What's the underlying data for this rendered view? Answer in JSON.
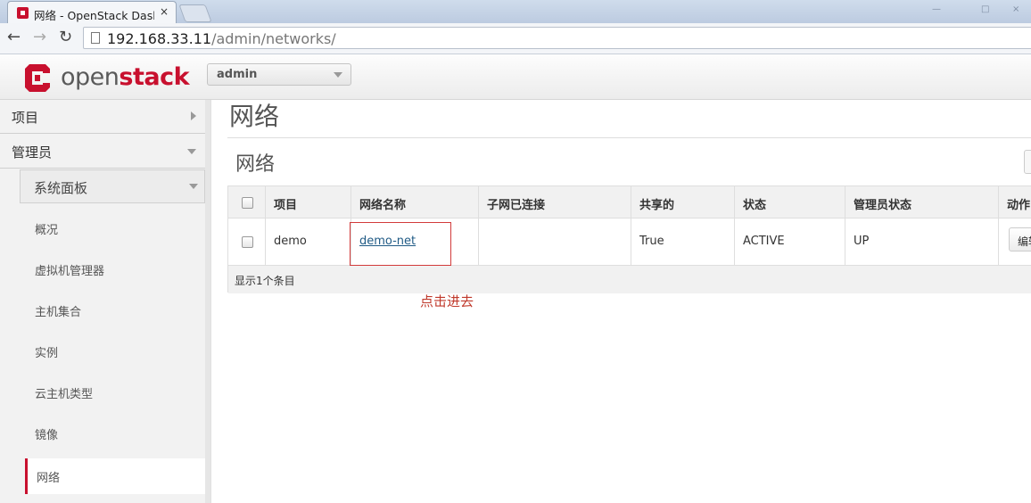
{
  "browser": {
    "tab_title": "网络 - OpenStack Dashb",
    "tab_close": "×",
    "url_host": "192.168.33.11",
    "url_path": "/admin/networks/",
    "window_controls": [
      "—",
      "□",
      "×"
    ]
  },
  "header": {
    "logo_open": "open",
    "logo_stack": "stack",
    "project": "admin"
  },
  "sidebar": {
    "project_label": "项目",
    "admin_label": "管理员",
    "system_panel_label": "系统面板",
    "items": [
      "概况",
      "虚拟机管理器",
      "主机集合",
      "实例",
      "云主机类型",
      "镜像",
      "网络"
    ],
    "active_item": "网络"
  },
  "main": {
    "page_title": "网络",
    "table_title": "网络",
    "columns": [
      "项目",
      "网络名称",
      "子网已连接",
      "共享的",
      "状态",
      "管理员状态",
      "动作"
    ],
    "rows": [
      {
        "project": "demo",
        "name": "demo-net",
        "subnets": "",
        "shared": "True",
        "status": "ACTIVE",
        "admin_state": "UP",
        "action": "编辑"
      }
    ],
    "footer": "显示1个条目",
    "annotation": "点击进去"
  },
  "colors": {
    "brand_red": "#c8102e",
    "link": "#1f5a85",
    "annotation": "#c0392b"
  }
}
